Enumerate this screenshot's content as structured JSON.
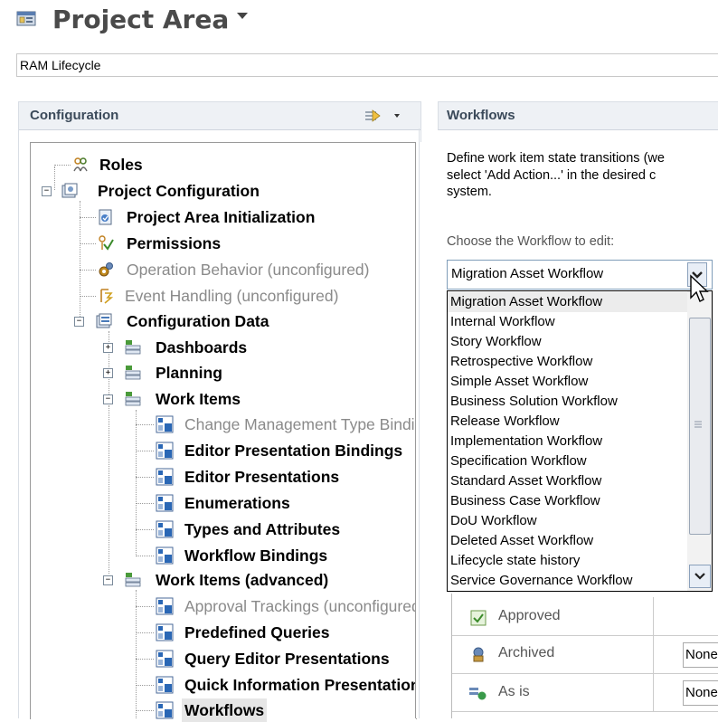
{
  "header": {
    "title": "Project Area",
    "subtitle": "RAM Lifecycle"
  },
  "config": {
    "title": "Configuration",
    "tree": [
      {
        "label": "Roles",
        "style": "bold",
        "icon": "roles-icon"
      },
      {
        "label": "Project Configuration",
        "style": "bold",
        "icon": "project-config-icon",
        "toggle": "−"
      },
      {
        "label": "Project Area Initialization",
        "style": "bold",
        "icon": "initialization-icon"
      },
      {
        "label": "Permissions",
        "style": "bold",
        "icon": "permissions-icon"
      },
      {
        "label": "Operation Behavior (unconfigured)",
        "style": "gray",
        "icon": "operation-behavior-icon"
      },
      {
        "label": "Event Handling (unconfigured)",
        "style": "gray",
        "icon": "event-handling-icon"
      },
      {
        "label": "Configuration Data",
        "style": "bold",
        "icon": "configuration-data-icon",
        "toggle": "−"
      },
      {
        "label": "Dashboards",
        "style": "bold",
        "icon": "dashboards-icon",
        "toggle": "+"
      },
      {
        "label": "Planning",
        "style": "bold",
        "icon": "planning-icon",
        "toggle": "+"
      },
      {
        "label": "Work Items",
        "style": "bold",
        "icon": "work-items-icon",
        "toggle": "−"
      },
      {
        "label": "Change Management Type Bindings",
        "style": "gray",
        "icon": "config-element-icon"
      },
      {
        "label": "Editor Presentation Bindings",
        "style": "bold",
        "icon": "config-element-icon"
      },
      {
        "label": "Editor Presentations",
        "style": "bold",
        "icon": "config-element-icon"
      },
      {
        "label": "Enumerations",
        "style": "bold",
        "icon": "config-element-icon"
      },
      {
        "label": "Types and Attributes",
        "style": "bold",
        "icon": "config-element-icon"
      },
      {
        "label": "Workflow Bindings",
        "style": "bold",
        "icon": "config-element-icon"
      },
      {
        "label": "Work Items (advanced)",
        "style": "bold",
        "icon": "work-items-icon",
        "toggle": "−"
      },
      {
        "label": "Approval Trackings (unconfigured)",
        "style": "gray",
        "icon": "config-element-icon"
      },
      {
        "label": "Predefined Queries",
        "style": "bold",
        "icon": "config-element-icon"
      },
      {
        "label": "Query Editor Presentations",
        "style": "bold",
        "icon": "config-element-icon"
      },
      {
        "label": "Quick Information Presentations",
        "style": "bold",
        "icon": "config-element-icon"
      },
      {
        "label": "Workflows",
        "style": "bold",
        "icon": "config-element-icon",
        "selected": true
      }
    ]
  },
  "workflows": {
    "title": "Workflows",
    "description": [
      "Define work item state transitions (we",
      "select 'Add Action...' in the desired c",
      "system."
    ],
    "choose_label": "Choose the Workflow to edit:",
    "selected": "Migration Asset Workflow",
    "options": [
      "Migration Asset Workflow",
      "Internal Workflow",
      "Story Workflow",
      "Retrospective Workflow",
      "Simple Asset Workflow",
      "Business Solution Workflow",
      "Release Workflow",
      "Implementation Workflow",
      "Specification Workflow",
      "Standard Asset Workflow",
      "Business Case Workflow",
      "DoU Workflow",
      "Deleted Asset Workflow",
      "Lifecycle state history",
      "Service Governance Workflow"
    ],
    "states": [
      {
        "label": "Approved",
        "icon": "approved-state-icon",
        "value": ""
      },
      {
        "label": "Archived",
        "icon": "archived-state-icon",
        "value": "None"
      },
      {
        "label": "As is",
        "icon": "as-is-state-icon",
        "value": "None"
      }
    ]
  },
  "colors": {
    "accent": "#3b4a5a",
    "selection": "#e6e6e6",
    "icon_blue": "#2a67b5"
  }
}
